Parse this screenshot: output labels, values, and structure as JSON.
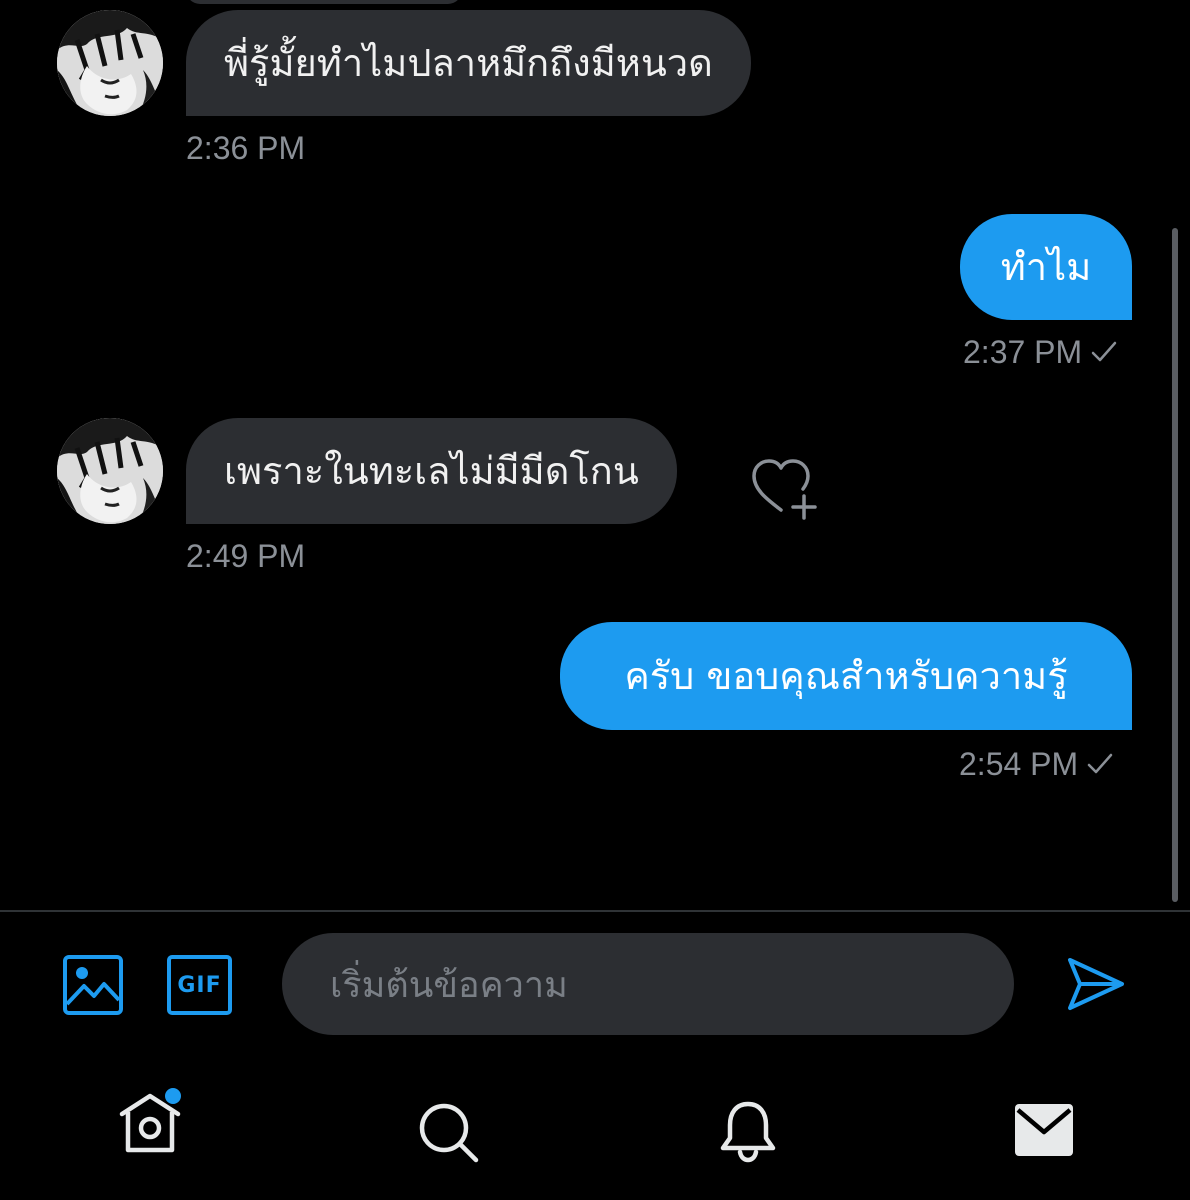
{
  "messages": [
    {
      "id": "m1",
      "direction": "received",
      "text": "พี่รู้มั้ยทำไมปลาหมึกถึงมีหนวด",
      "time": "2:36 PM"
    },
    {
      "id": "m2",
      "direction": "sent",
      "text": "ทำไม",
      "time": "2:37 PM",
      "status": "sent-check"
    },
    {
      "id": "m3",
      "direction": "received",
      "text": "เพราะในทะเลไม่มีมีดโกน",
      "time": "2:49 PM",
      "reaction_icon": "heart-plus-icon"
    },
    {
      "id": "m4",
      "direction": "sent",
      "text": "ครับ ขอบคุณสำหรับความรู้",
      "time": "2:54 PM",
      "status": "sent-check"
    }
  ],
  "composer": {
    "placeholder": "เริ่มต้นข้อความ",
    "gif_label": "GIF",
    "icons": [
      "image-icon",
      "gif-icon",
      "send-icon"
    ]
  },
  "tabbar": {
    "items": [
      "home-icon",
      "search-icon",
      "notifications-icon",
      "messages-icon"
    ],
    "home_has_notification_dot": true
  },
  "colors": {
    "background": "#000000",
    "accent": "#1d9bf0",
    "received_bubble": "#2c2e32",
    "timestamp": "#8b9097"
  }
}
